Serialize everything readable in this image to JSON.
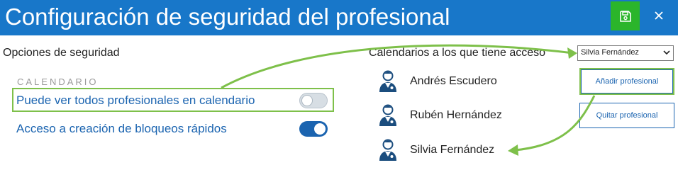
{
  "header": {
    "title": "Configuración de seguridad del profesional",
    "background": "#1877c9",
    "save_icon": "floppy-disk-icon",
    "close_icon": "close-icon"
  },
  "security_options": {
    "section_title": "Opciones de seguridad",
    "group_label": "CALENDARIO",
    "options": [
      {
        "label": "Puede ver todos profesionales en calendario",
        "enabled": false
      },
      {
        "label": "Acceso a creación de bloqueos rápidos",
        "enabled": true
      }
    ]
  },
  "calendars": {
    "title": "Calendarios a los que tiene acceso",
    "selected_professional": "Silvia Fernández",
    "professionals": [
      {
        "name": "Andrés Escudero",
        "icon": "doctor-avatar-icon"
      },
      {
        "name": "Rubén Hernández",
        "icon": "doctor-avatar-icon"
      },
      {
        "name": "Silvia Fernández",
        "icon": "doctor-avatar-icon"
      }
    ],
    "add_button": "Añadir profesional",
    "remove_button": "Quitar profesional"
  },
  "colors": {
    "accent": "#1b64b0",
    "save_green": "#2bb52b",
    "highlight_green": "#7ec04a"
  }
}
